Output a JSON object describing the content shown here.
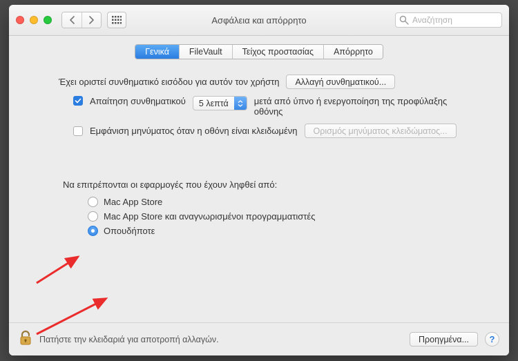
{
  "window": {
    "title": "Ασφάλεια και απόρρητο"
  },
  "search": {
    "placeholder": "Αναζήτηση"
  },
  "tabs": [
    {
      "label": "Γενικά",
      "active": true
    },
    {
      "label": "FileVault",
      "active": false
    },
    {
      "label": "Τείχος προστασίας",
      "active": false
    },
    {
      "label": "Απόρρητο",
      "active": false
    }
  ],
  "general": {
    "password_set_label": "Έχει οριστεί συνθηματικό εισόδου για αυτόν τον χρήστη",
    "change_password_btn": "Αλλαγή συνθηματικού...",
    "require_password_label": "Απαίτηση συνθηματικού",
    "require_password_checked": true,
    "delay_select_value": "5 λεπτά",
    "after_sleep_label": "μετά από ύπνο ή ενεργοποίηση της προφύλαξης οθόνης",
    "show_lock_message_label": "Εμφάνιση μηνύματος όταν η οθόνη είναι κλειδωμένη",
    "show_lock_message_checked": false,
    "set_lock_message_btn": "Ορισμός μηνύματος κλειδώματος..."
  },
  "allow_apps": {
    "heading": "Να επιτρέπονται οι εφαρμογές που έχουν ληφθεί από:",
    "options": [
      {
        "label": "Mac App Store",
        "checked": false
      },
      {
        "label": "Mac App Store και αναγνωρισμένοι προγραμματιστές",
        "checked": false
      },
      {
        "label": "Οπουδήποτε",
        "checked": true
      }
    ]
  },
  "footer": {
    "lock_text": "Πατήστε την κλειδαριά για αποτροπή αλλαγών.",
    "advanced_btn": "Προηγμένα...",
    "help_label": "?"
  },
  "colors": {
    "accent": "#2b7de0",
    "arrow": "#ea2c2c"
  }
}
